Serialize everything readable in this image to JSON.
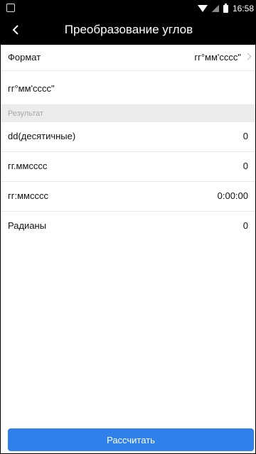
{
  "status_bar": {
    "time": "16:58"
  },
  "header": {
    "title": "Преобразование углов"
  },
  "format": {
    "label": "Формат",
    "value": "гг°мм'сссс\""
  },
  "input": {
    "value": "гг°мм'сссс\""
  },
  "result_section": {
    "label": "Результат"
  },
  "results": [
    {
      "label": "dd(десятичные)",
      "value": "0"
    },
    {
      "label": "гг.ммсссс",
      "value": "0"
    },
    {
      "label": "гг:ммсссс",
      "value": "0:00:00"
    },
    {
      "label": "Радианы",
      "value": "0"
    }
  ],
  "actions": {
    "calculate_label": "Рассчитать"
  },
  "colors": {
    "accent": "#2f80ea",
    "topbar": "#000000",
    "section_bg": "#ececec"
  }
}
